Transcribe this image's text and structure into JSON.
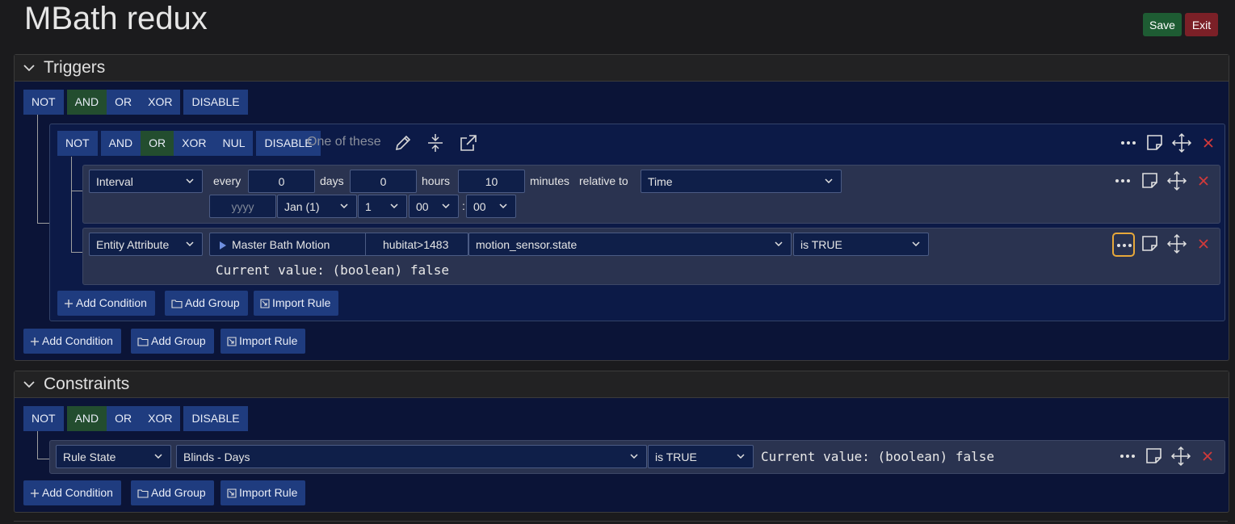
{
  "page_title": "MBath redux",
  "header": {
    "save_label": "Save",
    "exit_label": "Exit"
  },
  "ops": {
    "not": "NOT",
    "and": "AND",
    "or": "OR",
    "xor": "XOR",
    "nul": "NUL",
    "disable": "DISABLE"
  },
  "actions": {
    "add_condition": "Add Condition",
    "add_group": "Add Group",
    "import_rule": "Import Rule"
  },
  "triggers": {
    "title": "Triggers",
    "root_op": "AND",
    "group": {
      "op": "OR",
      "label": "One of these",
      "interval": {
        "type": "Interval",
        "every_label": "every",
        "days": "0",
        "days_label": "days",
        "hours": "0",
        "hours_label": "hours",
        "minutes": "10",
        "minutes_label": "minutes",
        "relative_label": "relative to",
        "relative": "Time",
        "year_placeholder": "yyyy",
        "month": "Jan (1)",
        "day": "1",
        "hour": "00",
        "time_sep": ":",
        "minute": "00"
      },
      "entity": {
        "type": "Entity Attribute",
        "entity_name": "Master Bath Motion",
        "entity_id": "hubitat>1483",
        "attribute": "motion_sensor.state",
        "operator": "is TRUE",
        "current_value": "Current value: (boolean) false"
      }
    }
  },
  "constraints": {
    "title": "Constraints",
    "root_op": "AND",
    "rule_state": {
      "type": "Rule State",
      "rule": "Blinds - Days",
      "operator": "is TRUE",
      "current_value": "Current value: (boolean) false"
    }
  },
  "colors": {
    "op_bg": "#1f3c7f",
    "op_active": "#234d2f",
    "save": "#1e5c33",
    "exit": "#7b2027",
    "close": "#d23a3a",
    "highlight": "#e7a83a"
  }
}
